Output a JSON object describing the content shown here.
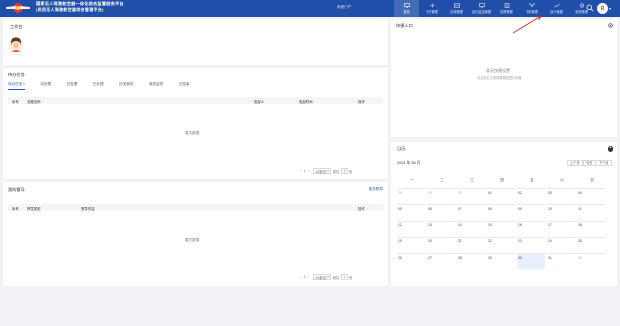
{
  "header": {
    "title_line1": "国家无人驾驶航空器一体化综合监管服务平台",
    "title_line2": "(民用无人驾驶航空器综合管理平台)",
    "home_label": "系统门户",
    "nav": [
      {
        "label": "首页",
        "icon": "monitor-icon",
        "active": true
      },
      {
        "label": "飞行管理",
        "icon": "plane-icon"
      },
      {
        "label": "空域管理",
        "icon": "airspace-icon"
      },
      {
        "label": "运行监控管理",
        "icon": "monitor-icon"
      },
      {
        "label": "执照管理",
        "icon": "license-icon"
      },
      {
        "label": "飞机管理",
        "icon": "drone-icon"
      },
      {
        "label": "运行管理",
        "icon": "operation-icon"
      },
      {
        "label": "系统管理",
        "icon": "settings-icon"
      }
    ],
    "user_avatar_text": "R",
    "colors": {
      "primary": "#1f4fa8",
      "accent": "#1f5fbf",
      "annotation": "#c62828"
    }
  },
  "workbench": {
    "title": "工作台",
    "avatar_icon": "user-avatar-icon"
  },
  "todo": {
    "title": "待办任务",
    "tabs": [
      "待办任务",
      "未处理",
      "已处理",
      "已办理",
      "抄送我的",
      "我发起的",
      "已结束"
    ],
    "columns": [
      "序号",
      "流程名称",
      "发起人",
      "发起时间",
      "操作"
    ],
    "empty_text": "暂无数据",
    "pager": {
      "prev": "<",
      "page": "1",
      "next": ">",
      "page_size": "10条/页",
      "goto_label": "前往",
      "goto_value": "1",
      "page_unit": "页"
    }
  },
  "supervise": {
    "title": "我的督导",
    "more_link": "更多督导",
    "columns": [
      "序号",
      "督导类型",
      "督导内容",
      "操作"
    ],
    "empty_text": "暂无数据",
    "pager": {
      "prev": "<",
      "page": "1",
      "next": ">",
      "page_size": "10条/页",
      "goto_label": "前往",
      "goto_value": "1",
      "page_unit": "页"
    }
  },
  "quick": {
    "title": "快捷入口",
    "empty_title": "暂无快捷设置",
    "empty_sub": "请点击右上角设置按钮进行设置"
  },
  "calendar": {
    "title": "日历",
    "month": "2024 年 08 月",
    "buttons": [
      "上个月",
      "今天",
      "下个月"
    ],
    "weekdays": [
      "一",
      "二",
      "三",
      "四",
      "五",
      "六",
      "日"
    ],
    "days": [
      {
        "d": "29",
        "other": true
      },
      {
        "d": "30",
        "other": true
      },
      {
        "d": "31",
        "other": true
      },
      {
        "d": "01"
      },
      {
        "d": "02"
      },
      {
        "d": "03"
      },
      {
        "d": "04"
      },
      {
        "d": "05"
      },
      {
        "d": "06"
      },
      {
        "d": "07"
      },
      {
        "d": "08"
      },
      {
        "d": "09"
      },
      {
        "d": "10"
      },
      {
        "d": "11"
      },
      {
        "d": "12"
      },
      {
        "d": "13"
      },
      {
        "d": "14"
      },
      {
        "d": "15"
      },
      {
        "d": "16"
      },
      {
        "d": "17"
      },
      {
        "d": "18"
      },
      {
        "d": "19"
      },
      {
        "d": "20"
      },
      {
        "d": "21"
      },
      {
        "d": "22"
      },
      {
        "d": "23"
      },
      {
        "d": "24"
      },
      {
        "d": "25"
      },
      {
        "d": "26"
      },
      {
        "d": "27"
      },
      {
        "d": "28"
      },
      {
        "d": "29"
      },
      {
        "d": "30",
        "today": true
      },
      {
        "d": "31"
      },
      {
        "d": "01",
        "other": true
      }
    ]
  }
}
